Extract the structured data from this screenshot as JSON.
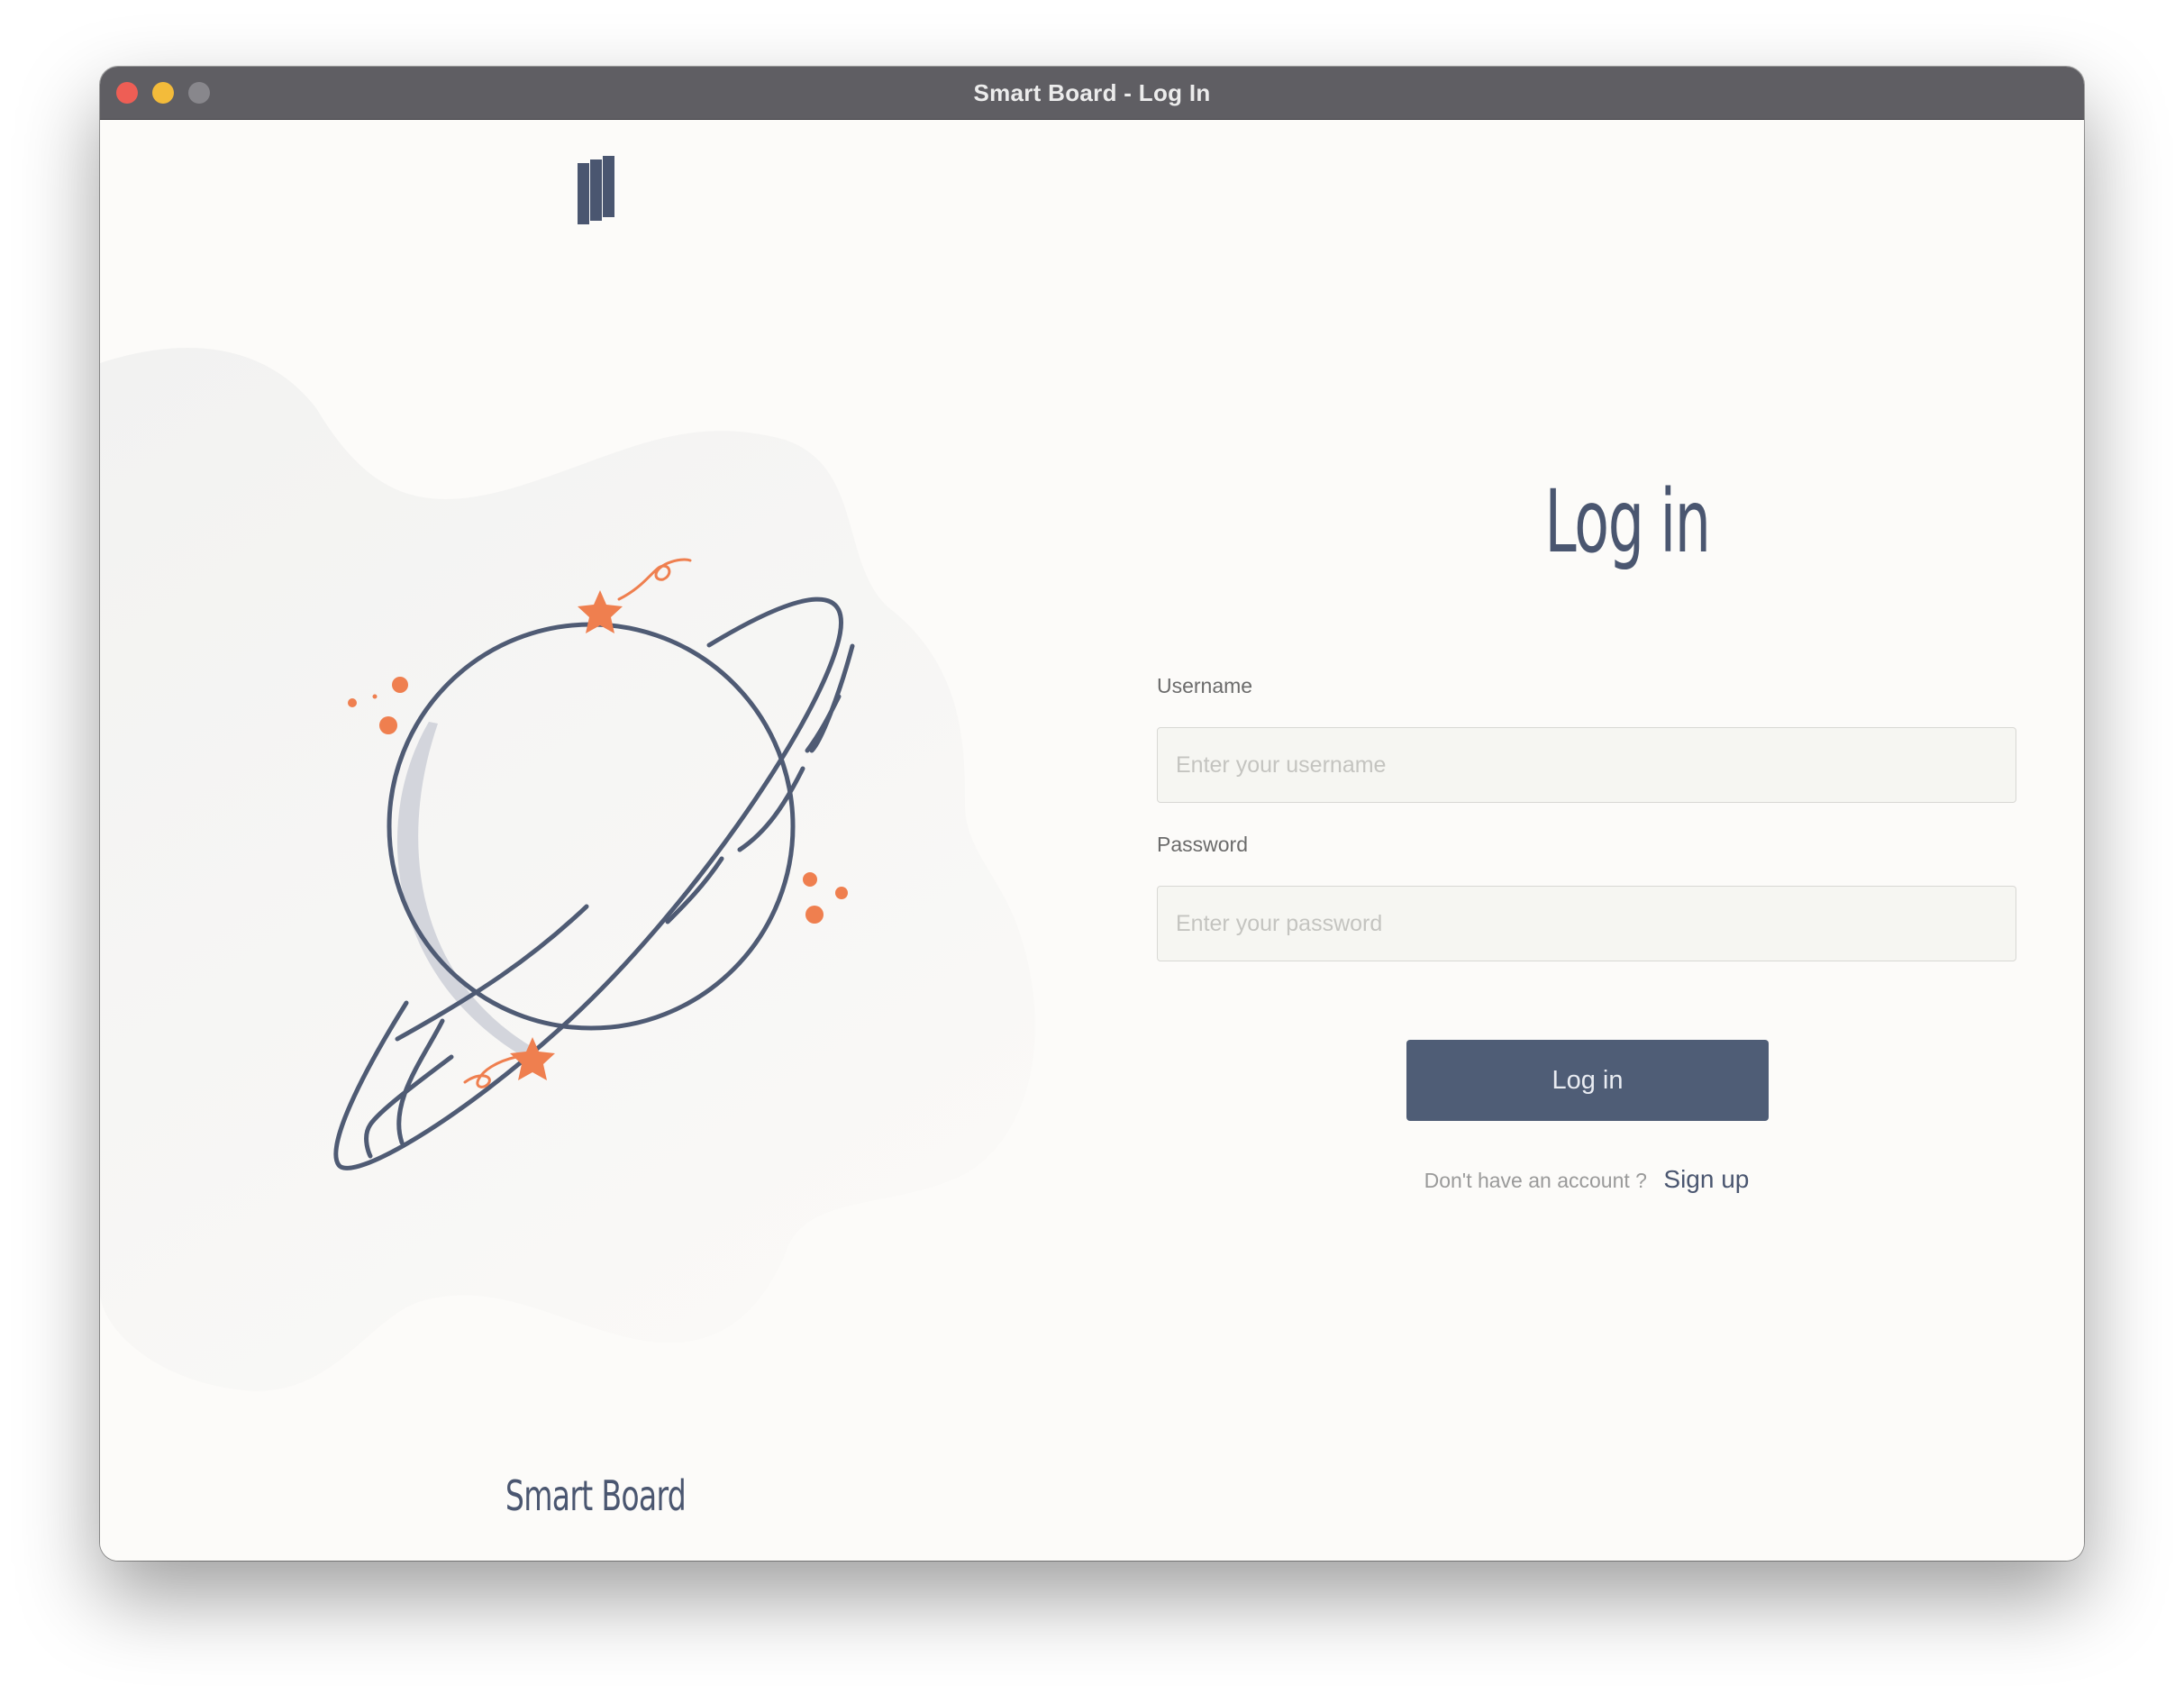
{
  "window": {
    "title": "Smart Board - Log In"
  },
  "brand": {
    "name": "Smart Board",
    "logo_icon": "stacked-bars-logo-icon",
    "color": "#4a5670"
  },
  "illustration": {
    "icon": "planet-illustration-icon",
    "accent_color": "#ef7f4f"
  },
  "form": {
    "heading": "Log in",
    "username": {
      "label": "Username",
      "placeholder": "Enter your username",
      "value": ""
    },
    "password": {
      "label": "Password",
      "placeholder": "Enter your password",
      "value": ""
    },
    "submit_label": "Log in",
    "signup_prompt": "Don't have an account ?",
    "signup_link": "Sign up",
    "button_color": "#4f5d76"
  }
}
